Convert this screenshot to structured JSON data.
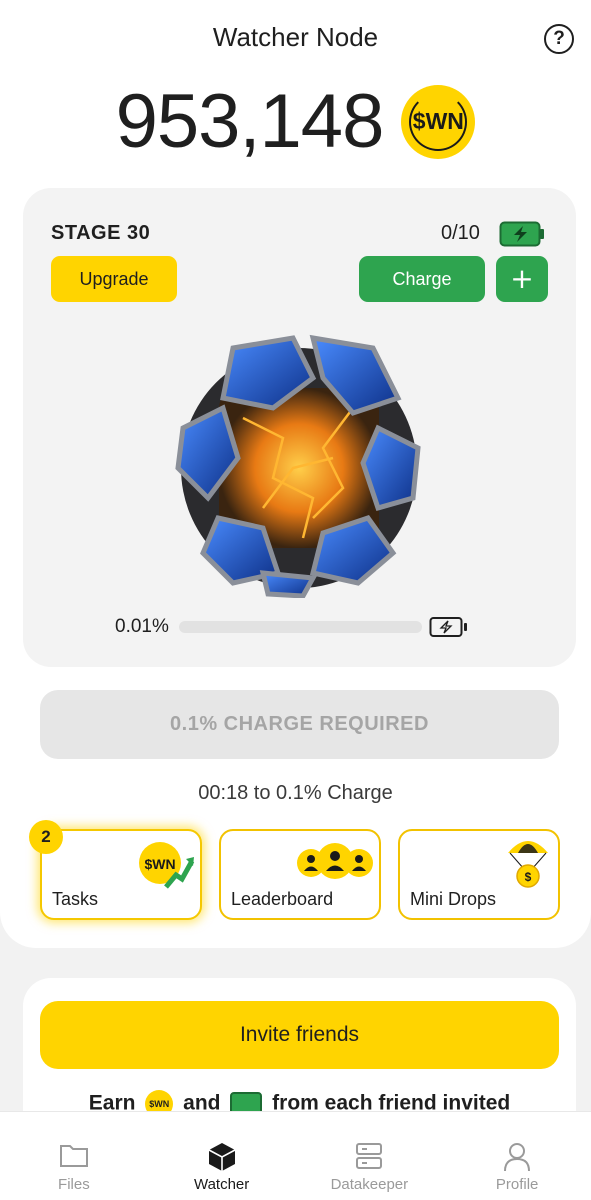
{
  "header": {
    "title": "Watcher Node",
    "help_icon": "question-icon"
  },
  "balance": {
    "value": "953,148",
    "token": "$WN"
  },
  "stage": {
    "label": "STAGE 30",
    "charges": "0/10",
    "upgrade_label": "Upgrade",
    "charge_label": "Charge",
    "plus_label": "+",
    "progress_text": "0.01%",
    "progress_fraction": 0.0001
  },
  "charge_required": "0.1% CHARGE REQUIRED",
  "timer": "00:18 to 0.1% Charge",
  "features": [
    {
      "label": "Tasks",
      "badge": "2",
      "icon": "wn-coin-growth-icon"
    },
    {
      "label": "Leaderboard",
      "icon": "people-icon"
    },
    {
      "label": "Mini Drops",
      "icon": "parachute-coin-icon"
    }
  ],
  "invite": {
    "button_label": "Invite friends",
    "earn_prefix": "Earn",
    "earn_coin": "$WN",
    "earn_and": "and",
    "earn_suffix": "from each friend invited"
  },
  "nav": [
    {
      "label": "Files",
      "icon": "folder-icon",
      "active": false
    },
    {
      "label": "Watcher",
      "icon": "cube-icon",
      "active": true
    },
    {
      "label": "Datakeeper",
      "icon": "server-icon",
      "active": false
    },
    {
      "label": "Profile",
      "icon": "person-icon",
      "active": false
    }
  ],
  "colors": {
    "accent_yellow": "#ffd400",
    "accent_green": "#2ea44f",
    "muted": "#a5a5a5"
  }
}
